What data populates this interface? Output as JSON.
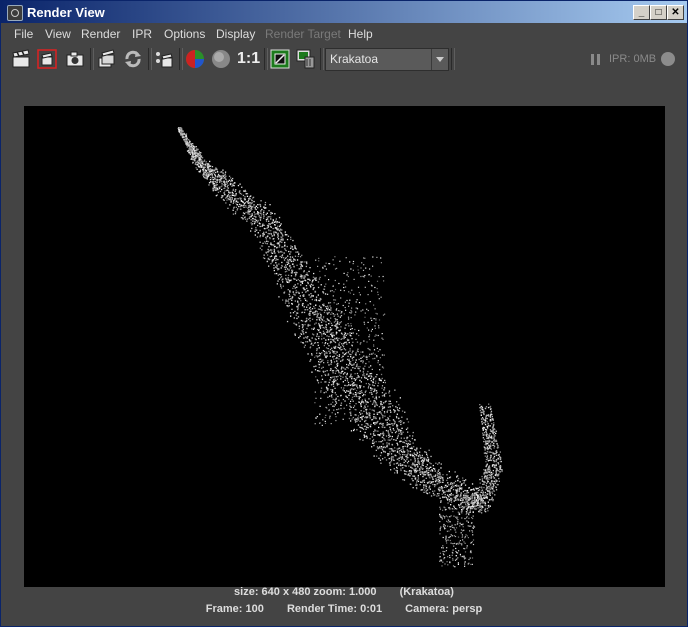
{
  "window": {
    "title": "Render View"
  },
  "menu": {
    "file": "File",
    "view": "View",
    "render": "Render",
    "ipr": "IPR",
    "options": "Options",
    "display": "Display",
    "render_target": "Render Target",
    "help": "Help"
  },
  "toolbar": {
    "ratio_label": "1:1",
    "renderer": "Krakatoa",
    "ipr_memory": "IPR: 0MB",
    "icons": [
      "redo-render-icon",
      "render-region-icon",
      "snapshot-icon",
      "render-sequence-icon",
      "refresh-icon",
      "keep-image-icon",
      "color-channels-icon",
      "alpha-icon",
      "real-size-icon",
      "color-management-icon",
      "remove-image-icon",
      "pause-icon",
      "ipr-status-icon"
    ]
  },
  "status": {
    "size": "size: 640 x 480 zoom: 1.000",
    "renderer": "(Krakatoa)",
    "frame": "Frame: 100",
    "render_time": "Render Time: 0:01",
    "camera": "Camera: persp"
  }
}
